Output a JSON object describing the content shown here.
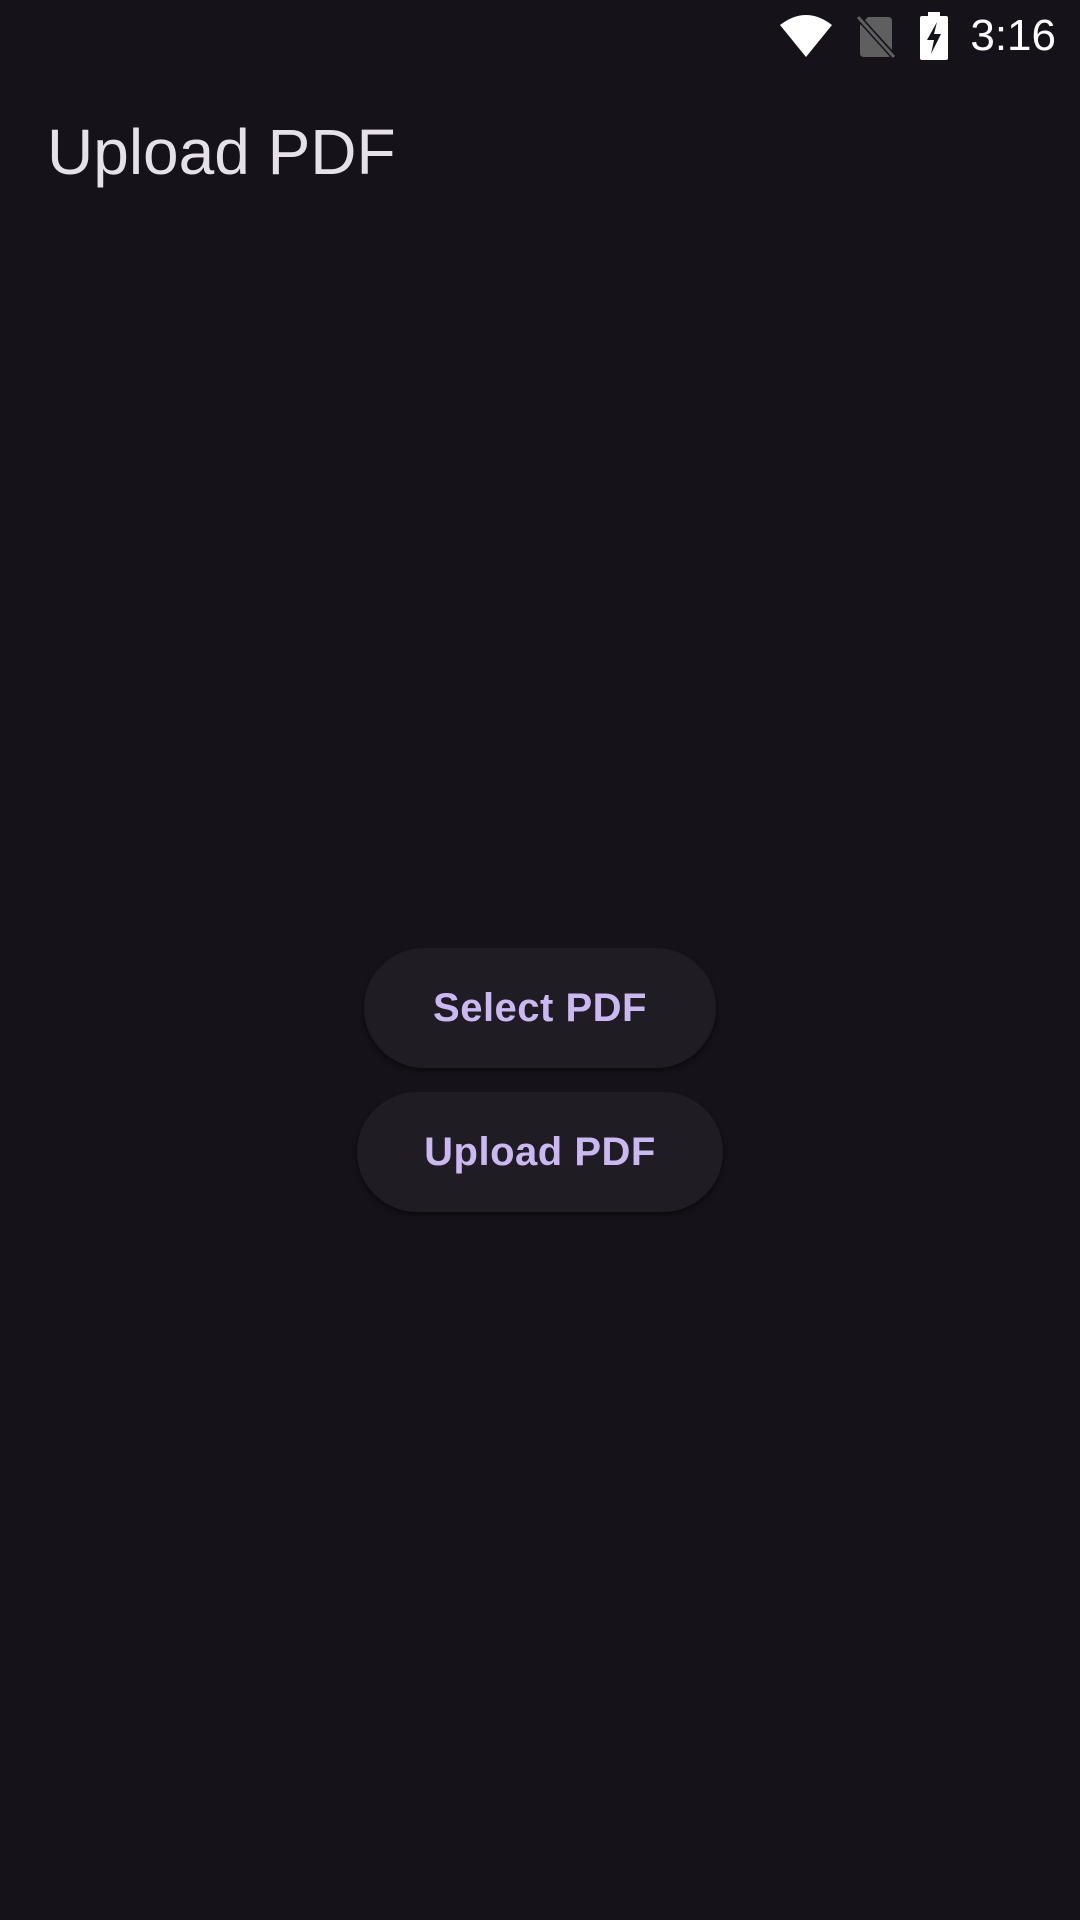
{
  "status_bar": {
    "time": "3:16",
    "icons": [
      "wifi-icon",
      "no-sim-icon",
      "battery-charging-icon"
    ]
  },
  "header": {
    "title": "Upload PDF"
  },
  "actions": {
    "select_label": "Select PDF",
    "upload_label": "Upload PDF"
  },
  "colors": {
    "background": "#15121a",
    "button_surface": "#1f1d23",
    "button_text": "#cbb8f2",
    "title_text": "#e6e0e9"
  }
}
